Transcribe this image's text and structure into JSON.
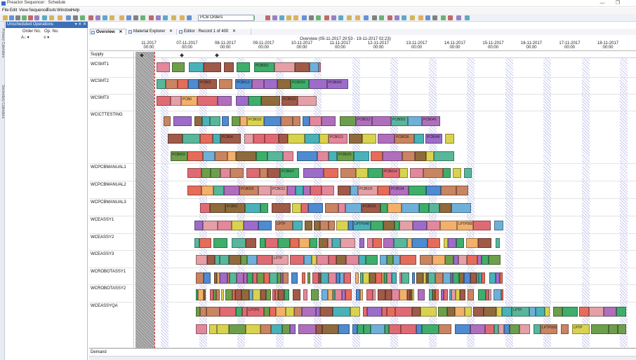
{
  "window": {
    "title": "Preactor Sequencer : Schedule",
    "minimize_glyph": "—",
    "restore_glyph": "❐"
  },
  "menu": [
    "File",
    "Edit",
    "View",
    "Sequence",
    "Tools",
    "Window",
    "Help"
  ],
  "toolbar": {
    "order_select_value": "PCB Orders",
    "icons": [
      "open-icon",
      "save-icon",
      "print-icon",
      "undo-icon",
      "redo-icon",
      "grid-icon",
      "filter-icon",
      "zoom-icon",
      "chart-icon",
      "sequence-icon",
      "check-icon",
      "calendar-icon"
    ]
  },
  "side_tabs": [
    "Primary Calendars",
    "Secondary Calendars"
  ],
  "unscheduled_panel": {
    "title": "Unscheduled Operations",
    "buttons": "▾ ✕ ✕",
    "columns": [
      "Order No.",
      "Op. No."
    ],
    "controls": [
      "A↓ ▾",
      "≡ ▾"
    ]
  },
  "tabs": [
    {
      "label": "Overview",
      "close": "✕",
      "active": true
    },
    {
      "label": "Material Explorer",
      "close": "✕",
      "active": false
    },
    {
      "label": "Editor : Record 1 of 400",
      "close": "✕",
      "active": false
    }
  ],
  "gantt": {
    "overview_text": "Overview  (05-11-2017 20:53 - 19-11-2017 02:23)",
    "dates": [
      "11-2017\n00:00",
      "07-11-2017\n00:00",
      "08-11-2017\n00:00",
      "09-11-2017\n00:00",
      "10-11-2017\n00:00",
      "11-11-2017\n00:00",
      "12-11-2017\n00:00",
      "13-11-2017\n00:00",
      "14-11-2017\n00:00",
      "15-11-2017\n00:00",
      "16-11-2017\n00:00",
      "17-11-2017\n00:00",
      "18-11-2017\n00:00",
      "19-11-20\n00:00"
    ],
    "supply_label": "Supply",
    "demand_label": "Demand",
    "resources": [
      "WCSMT1",
      "WCSMT2",
      "WCSMT3",
      "WCICTTESTING",
      "WCPCBMANUAL1",
      "WCPCBMANUAL2",
      "WCPCBMANUAL3",
      "WCEASSY1",
      "WCEASSY2",
      "WCEASSY3",
      "WCROBOTASSY1",
      "WCROBOTASSY2",
      "WCEASSYQA"
    ],
    "colors": {
      "past": "#a6a6a6",
      "now_line": "#e0282a",
      "hatch": "#c7c9ee",
      "header_accent": "#3d6fb8"
    },
    "bar_labels": {
      "smt1": [
        "PCB001",
        "PCB012",
        "PCB015",
        "PCB025",
        "PCB035",
        "PCB055"
      ],
      "smt2": [
        "PCB01",
        "PCB013",
        "PCB033",
        "PCB043",
        "PCB054"
      ],
      "smt3": [
        "PCB0",
        "PCB022",
        "PCB04"
      ],
      "ict1": [
        "PCB032",
        "PCB012",
        "PCB052",
        "PCB045",
        "PCB065"
      ],
      "ict2": [
        "PCB04",
        "PCB013",
        "PCB036",
        "PCB046"
      ],
      "ict3": [
        "PCB003",
        "PCB025",
        "PCB047"
      ],
      "man1": [
        "PCB007",
        "PCB014",
        "PCB023",
        "PCB033",
        "PCB043"
      ],
      "man2": [
        "PCB005",
        "PCB011",
        "PCB025",
        "PCB034",
        "PCB055"
      ],
      "man3": [
        "PCB01",
        "PCB026",
        "PCB035",
        "PCB043",
        "PCB052"
      ],
      "ea1": [
        "LPTP",
        "LPTP048",
        "LPTP068"
      ],
      "ea2": [
        "LPTP",
        "LPTP101",
        "LPTP"
      ],
      "ea3": [
        "LPTP",
        "LPTP0"
      ],
      "ro1": [
        "LPTP",
        "LPTP1"
      ],
      "ro2": [
        "LPTP"
      ],
      "qa1": [
        "LPTP0",
        "LPTP",
        "LPTP124"
      ],
      "qa2": [
        "LPTP006",
        "LPTP",
        "LPTP"
      ]
    }
  }
}
